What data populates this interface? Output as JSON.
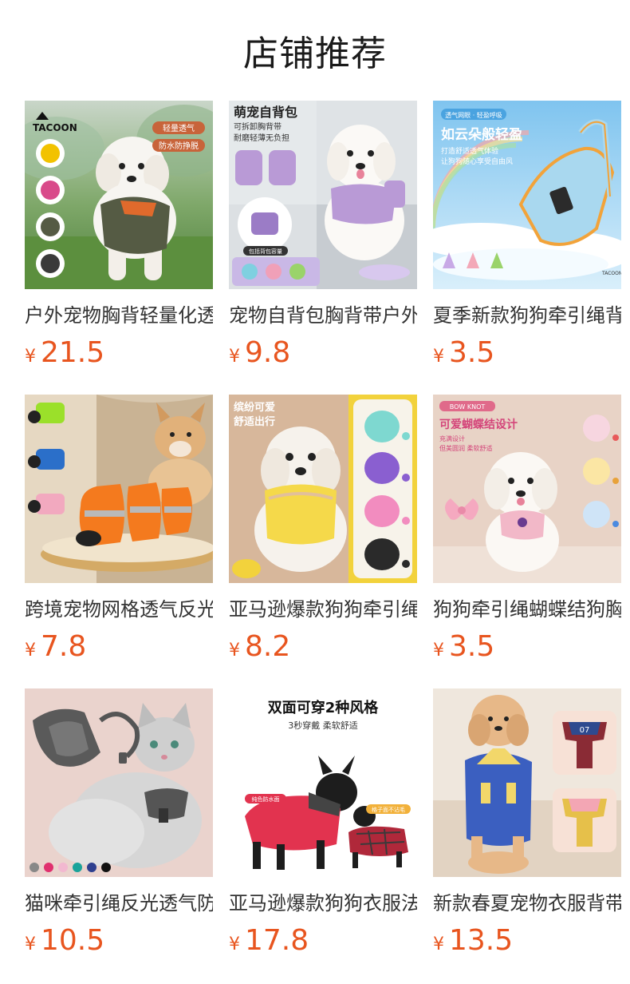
{
  "page": {
    "title": "店铺推荐"
  },
  "currency_symbol": "¥",
  "products": [
    {
      "name": "户外宠物胸背轻量化透气",
      "price": "21.5",
      "image": {
        "brand": "TACOON",
        "badges": [
          "轻量透气",
          "防水防挣脱"
        ],
        "swatch_colors": [
          "#f2c200",
          "#d94a8a",
          "#555b44",
          "#3a3a3a"
        ]
      }
    },
    {
      "name": "宠物自背包胸背带户外",
      "price": "9.8",
      "image": {
        "headline": "萌宠自背包",
        "sub_lines": [
          "可拆卸胸背带",
          "耐磨轻薄无负担"
        ],
        "tag": "包括背包容量"
      }
    },
    {
      "name": "夏季新款狗狗牵引绳背心",
      "price": "3.5",
      "image": {
        "ribbon": "透气网眼 · 轻盈呼吸",
        "headline": "如云朵般轻盈",
        "sub_lines": [
          "打造舒适透气体验",
          "让狗狗随心享受自由风"
        ],
        "brand": "TACOON"
      }
    },
    {
      "name": "跨境宠物网格透气反光鞋",
      "price": "7.8",
      "image": {}
    },
    {
      "name": "亚马逊爆款狗狗牵引绳套装",
      "price": "8.2",
      "image": {
        "headline_lines": [
          "缤纷可爱",
          "舒适出行"
        ]
      }
    },
    {
      "name": "狗狗牵引绳蝴蝶结狗胸背",
      "price": "3.5",
      "image": {
        "ribbon": "BOW KNOT",
        "headline": "可爱蝴蝶结设计",
        "sub_lines": [
          "充满设计",
          "但美圆润 柔软舒适"
        ]
      }
    },
    {
      "name": "猫咪牵引绳反光透气防挣脱",
      "price": "10.5",
      "image": {
        "swatch_colors": [
          "#888888",
          "#e0306e",
          "#f2b8d0",
          "#1aa39a",
          "#2e3f8f",
          "#111111"
        ]
      }
    },
    {
      "name": "亚马逊爆款狗狗衣服法斗",
      "price": "17.8",
      "image": {
        "headline": "双面可穿2种风格",
        "sub_line": "3秒穿戴 柔软舒适",
        "tag_left": "纯色防水面",
        "tag_right": "格子面不沾毛"
      }
    },
    {
      "name": "新款春夏宠物衣服背带裤",
      "price": "13.5",
      "image": {
        "jersey_number": "07"
      }
    }
  ]
}
